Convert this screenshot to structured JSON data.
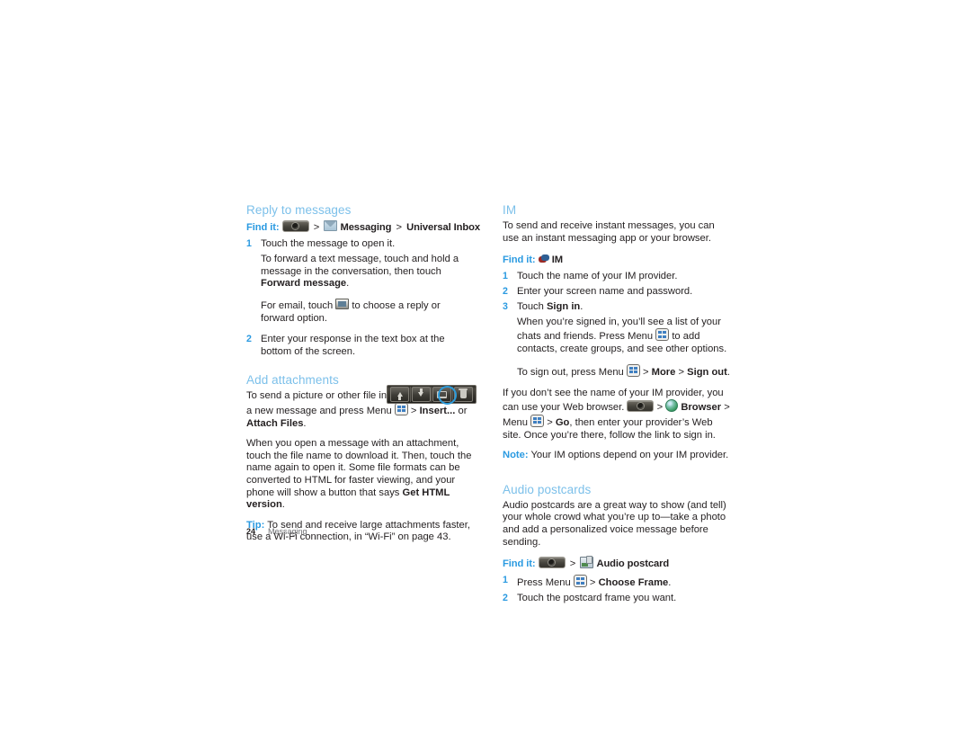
{
  "document": {
    "page_number": "24",
    "footer_section": "Messaging"
  },
  "left_column": {
    "reply_section": {
      "heading": "Reply to messages",
      "find_it": {
        "label": "Find it:",
        "home_icon": "home-key-icon",
        "sep1": ">",
        "app_icon": "messaging-envelope-icon",
        "app": "Messaging",
        "sep2": ">",
        "target": "Universal Inbox"
      },
      "step1": {
        "num": "1",
        "text": "Touch the message to open it."
      },
      "para_forward_a": "To forward a text message, touch and hold a message in the conversation, then touch ",
      "para_forward_bold": "Forward message",
      "para_forward_b": ".",
      "para_email_a": "For email, touch ",
      "para_email_icon": "reply-icon",
      "para_email_b": " to choose a reply or forward option.",
      "step2": {
        "num": "2",
        "text": "Enter your response in the text box at the bottom of the screen."
      },
      "actionbar": {
        "buttons": [
          "arrow-up-icon",
          "arrow-down-icon",
          "reply-icon",
          "trash-icon"
        ],
        "highlighted_index": 2,
        "highlight_color": "#2c9bdb"
      }
    },
    "attachments_section": {
      "heading": "Add attachments",
      "para1_a": "To send a picture or other file in a message, open a new message and press Menu ",
      "para1_menu_icon": "menu-key-icon",
      "para1_b": " > ",
      "para1_bold1": "Insert...",
      "para1_c": " or ",
      "para1_bold2": "Attach Files",
      "para1_d": ".",
      "para2_a": "When you open a message with an attachment, touch the file name to download it. Then, touch the name again to open it. Some file formats can be converted to HTML for faster viewing, and your phone will show a button that says ",
      "para2_bold": "Get HTML version",
      "para2_b": ".",
      "tip_label": "Tip:",
      "tip_text": " To send and receive large attachments faster, use a Wi-Fi connection, in “Wi-Fi” on page 43."
    }
  },
  "right_column": {
    "im_section": {
      "heading": "IM",
      "intro": "To send and receive instant messages, you can use an instant messaging app or your browser.",
      "find_it": {
        "label": "Find it:",
        "app_icon": "im-bubbles-icon",
        "app": "IM"
      },
      "step1": {
        "num": "1",
        "text": "Touch the name of your IM provider."
      },
      "step2": {
        "num": "2",
        "text": "Enter your screen name and password."
      },
      "step3": {
        "num": "3",
        "text_a": "Touch ",
        "bold": "Sign in",
        "text_b": "."
      },
      "para_signed_a": "When you’re signed in, you’ll see a list of your chats and friends. Press Menu ",
      "para_signed_icon": "menu-key-icon",
      "para_signed_b": " to add contacts, create groups, and see other options.",
      "para_signout_a": "To sign out, press Menu ",
      "para_signout_icon": "menu-key-icon",
      "para_signout_b": " > ",
      "para_signout_bold1": "More",
      "para_signout_c": " > ",
      "para_signout_bold2": "Sign out",
      "para_signout_d": ".",
      "para_browser_a": "If you don’t see the name of your IM provider, you can use your Web browser. ",
      "para_browser_home_icon": "home-key-icon",
      "para_browser_b": " > ",
      "para_browser_globe_icon": "browser-globe-icon",
      "para_browser_bold1": "Browser",
      "para_browser_c": " > Menu ",
      "para_browser_menu_icon": "menu-key-icon",
      "para_browser_d": " > ",
      "para_browser_bold2": "Go",
      "para_browser_e": ", then enter your provider’s Web site. Once you’re there, follow the link to sign in.",
      "note_label": "Note:",
      "note_text": " Your IM options depend on your IM provider."
    },
    "audio_postcards_section": {
      "heading": "Audio postcards",
      "intro": "Audio postcards are a great way to show (and tell) your whole crowd what you’re up to—take a photo and add a personalized voice message before sending.",
      "find_it": {
        "label": "Find it:",
        "home_icon": "home-key-icon",
        "sep1": ">",
        "app_icon": "audio-postcard-icon",
        "app": "Audio postcard"
      },
      "step1": {
        "num": "1",
        "text_a": "Press Menu ",
        "menu_icon": "menu-key-icon",
        "text_b": " > ",
        "bold": "Choose Frame",
        "text_c": "."
      },
      "step2": {
        "num": "2",
        "text": "Touch the postcard frame you want."
      }
    }
  },
  "colors": {
    "heading_blue": "#7cc0ea",
    "accent_blue": "#2a9ae1",
    "body_text": "#231f20",
    "footer_grey": "#6d6e71"
  }
}
